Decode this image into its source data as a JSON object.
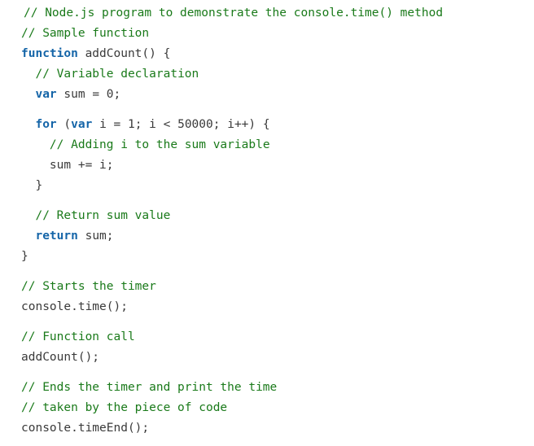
{
  "editor": {
    "language": "javascript",
    "background_color": "#ffffff",
    "colors": {
      "comment": "#1a7a1a",
      "keyword": "#1565a8",
      "plain": "#3a3a3a"
    }
  },
  "code": {
    "lines": [
      {
        "id": "line-1",
        "kind": "comment",
        "indent": 0,
        "shift": true,
        "tokens": [
          {
            "type": "comment",
            "text": "// Node.js program to demonstrate the console.time() method"
          }
        ]
      },
      {
        "id": "line-2",
        "kind": "comment",
        "indent": 0,
        "tokens": [
          {
            "type": "comment",
            "text": "// Sample function"
          }
        ]
      },
      {
        "id": "line-3",
        "kind": "code",
        "indent": 0,
        "tokens": [
          {
            "type": "keyword",
            "text": "function"
          },
          {
            "type": "plain",
            "text": " addCount() {"
          }
        ]
      },
      {
        "id": "line-4",
        "kind": "comment",
        "indent": 2,
        "tokens": [
          {
            "type": "comment",
            "text": "// Variable declaration"
          }
        ]
      },
      {
        "id": "line-5",
        "kind": "code",
        "indent": 2,
        "tokens": [
          {
            "type": "keyword",
            "text": "var"
          },
          {
            "type": "plain",
            "text": " sum = 0;"
          }
        ]
      },
      {
        "id": "line-6",
        "kind": "blank",
        "indent": 0,
        "tokens": []
      },
      {
        "id": "line-7",
        "kind": "code",
        "indent": 2,
        "tokens": [
          {
            "type": "keyword",
            "text": "for"
          },
          {
            "type": "plain",
            "text": " ("
          },
          {
            "type": "keyword",
            "text": "var"
          },
          {
            "type": "plain",
            "text": " i = 1; i < 50000; i++) {"
          }
        ]
      },
      {
        "id": "line-8",
        "kind": "comment",
        "indent": 4,
        "tokens": [
          {
            "type": "comment",
            "text": "// Adding i to the sum variable"
          }
        ]
      },
      {
        "id": "line-9",
        "kind": "code",
        "indent": 4,
        "tokens": [
          {
            "type": "plain",
            "text": "sum += i;"
          }
        ]
      },
      {
        "id": "line-10",
        "kind": "code",
        "indent": 2,
        "tokens": [
          {
            "type": "plain",
            "text": "}"
          }
        ]
      },
      {
        "id": "line-11",
        "kind": "blank",
        "indent": 0,
        "tokens": []
      },
      {
        "id": "line-12",
        "kind": "comment",
        "indent": 2,
        "tokens": [
          {
            "type": "comment",
            "text": "// Return sum value"
          }
        ]
      },
      {
        "id": "line-13",
        "kind": "code",
        "indent": 2,
        "tokens": [
          {
            "type": "keyword",
            "text": "return"
          },
          {
            "type": "plain",
            "text": " sum;"
          }
        ]
      },
      {
        "id": "line-14",
        "kind": "code",
        "indent": 0,
        "tokens": [
          {
            "type": "plain",
            "text": "}"
          }
        ]
      },
      {
        "id": "line-15",
        "kind": "blank",
        "indent": 0,
        "tokens": []
      },
      {
        "id": "line-16",
        "kind": "comment",
        "indent": 0,
        "tokens": [
          {
            "type": "comment",
            "text": "// Starts the timer"
          }
        ]
      },
      {
        "id": "line-17",
        "kind": "code",
        "indent": 0,
        "tokens": [
          {
            "type": "plain",
            "text": "console.time();"
          }
        ]
      },
      {
        "id": "line-18",
        "kind": "blank",
        "indent": 0,
        "tokens": []
      },
      {
        "id": "line-19",
        "kind": "comment",
        "indent": 0,
        "tokens": [
          {
            "type": "comment",
            "text": "// Function call"
          }
        ]
      },
      {
        "id": "line-20",
        "kind": "code",
        "indent": 0,
        "tokens": [
          {
            "type": "plain",
            "text": "addCount();"
          }
        ]
      },
      {
        "id": "line-21",
        "kind": "blank",
        "indent": 0,
        "tokens": []
      },
      {
        "id": "line-22",
        "kind": "comment",
        "indent": 0,
        "tokens": [
          {
            "type": "comment",
            "text": "// Ends the timer and print the time"
          }
        ]
      },
      {
        "id": "line-23",
        "kind": "comment",
        "indent": 0,
        "tokens": [
          {
            "type": "comment",
            "text": "// taken by the piece of code"
          }
        ]
      },
      {
        "id": "line-24",
        "kind": "code",
        "indent": 0,
        "tokens": [
          {
            "type": "plain",
            "text": "console.timeEnd();"
          }
        ]
      }
    ]
  }
}
